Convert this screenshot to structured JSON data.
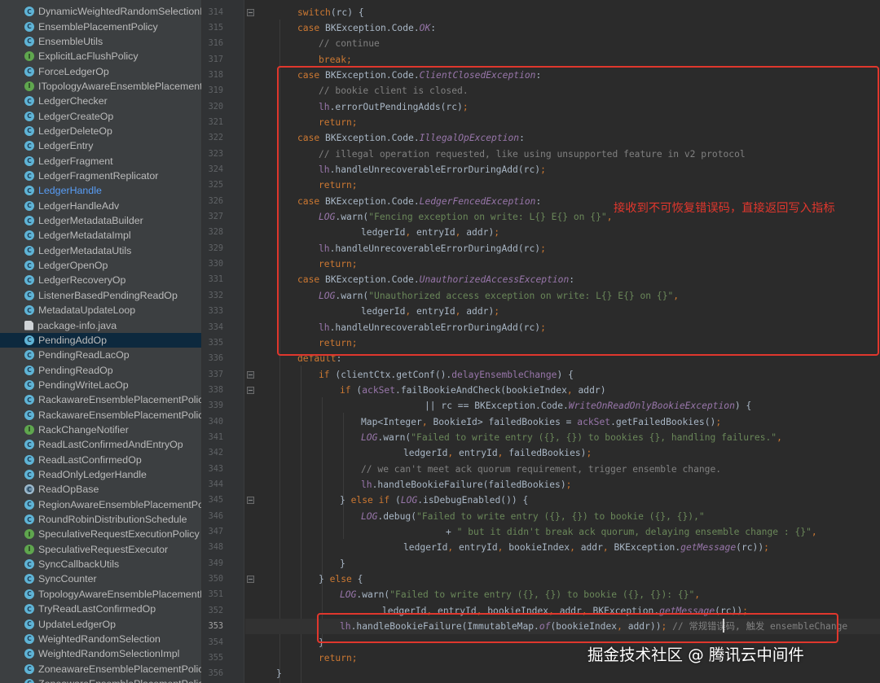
{
  "project_tree": {
    "items": [
      {
        "icon": "class",
        "label": "DynamicWeightedRandomSelectionI"
      },
      {
        "icon": "class",
        "label": "EnsemblePlacementPolicy"
      },
      {
        "icon": "class",
        "label": "EnsembleUtils"
      },
      {
        "icon": "interface",
        "label": "ExplicitLacFlushPolicy"
      },
      {
        "icon": "class",
        "label": "ForceLedgerOp"
      },
      {
        "icon": "interface",
        "label": "ITopologyAwareEnsemblePlacement"
      },
      {
        "icon": "class",
        "label": "LedgerChecker"
      },
      {
        "icon": "class",
        "label": "LedgerCreateOp"
      },
      {
        "icon": "class",
        "label": "LedgerDeleteOp"
      },
      {
        "icon": "class",
        "label": "LedgerEntry"
      },
      {
        "icon": "class",
        "label": "LedgerFragment"
      },
      {
        "icon": "class",
        "label": "LedgerFragmentReplicator"
      },
      {
        "icon": "class",
        "label": "LedgerHandle",
        "link": true
      },
      {
        "icon": "class",
        "label": "LedgerHandleAdv"
      },
      {
        "icon": "class",
        "label": "LedgerMetadataBuilder"
      },
      {
        "icon": "class",
        "label": "LedgerMetadataImpl"
      },
      {
        "icon": "class",
        "label": "LedgerMetadataUtils"
      },
      {
        "icon": "class",
        "label": "LedgerOpenOp"
      },
      {
        "icon": "class",
        "label": "LedgerRecoveryOp"
      },
      {
        "icon": "class",
        "label": "ListenerBasedPendingReadOp"
      },
      {
        "icon": "class",
        "label": "MetadataUpdateLoop"
      },
      {
        "icon": "file",
        "label": "package-info.java"
      },
      {
        "icon": "class",
        "label": "PendingAddOp",
        "selected": true
      },
      {
        "icon": "class",
        "label": "PendingReadLacOp"
      },
      {
        "icon": "class",
        "label": "PendingReadOp"
      },
      {
        "icon": "class",
        "label": "PendingWriteLacOp"
      },
      {
        "icon": "class",
        "label": "RackawareEnsemblePlacementPolicy"
      },
      {
        "icon": "class",
        "label": "RackawareEnsemblePlacementPolicy"
      },
      {
        "icon": "interface",
        "label": "RackChangeNotifier"
      },
      {
        "icon": "class",
        "label": "ReadLastConfirmedAndEntryOp"
      },
      {
        "icon": "class",
        "label": "ReadLastConfirmedOp"
      },
      {
        "icon": "class",
        "label": "ReadOnlyLedgerHandle"
      },
      {
        "icon": "abstract",
        "label": "ReadOpBase"
      },
      {
        "icon": "class",
        "label": "RegionAwareEnsemblePlacementPol"
      },
      {
        "icon": "class",
        "label": "RoundRobinDistributionSchedule"
      },
      {
        "icon": "interface",
        "label": "SpeculativeRequestExecutionPolicy"
      },
      {
        "icon": "interface",
        "label": "SpeculativeRequestExecutor"
      },
      {
        "icon": "class",
        "label": "SyncCallbackUtils"
      },
      {
        "icon": "class",
        "label": "SyncCounter"
      },
      {
        "icon": "class",
        "label": "TopologyAwareEnsemblePlacementP"
      },
      {
        "icon": "class",
        "label": "TryReadLastConfirmedOp"
      },
      {
        "icon": "class",
        "label": "UpdateLedgerOp"
      },
      {
        "icon": "class",
        "label": "WeightedRandomSelection"
      },
      {
        "icon": "class",
        "label": "WeightedRandomSelectionImpl"
      },
      {
        "icon": "class",
        "label": "ZoneawareEnsemblePlacementPolic"
      },
      {
        "icon": "class",
        "label": "ZoneawareEnsemblePlacementPolic"
      }
    ]
  },
  "editor": {
    "current_line": "353",
    "lines": [
      {
        "n": "314",
        "ind": 2,
        "fold": true,
        "segs": [
          [
            "kw",
            "switch"
          ],
          [
            "",
            "(rc) {"
          ]
        ]
      },
      {
        "n": "315",
        "ind": 2,
        "segs": [
          [
            "kw",
            "case "
          ],
          [
            "",
            "BKException.Code."
          ],
          [
            "it",
            "OK"
          ],
          [
            "",
            ":"
          ]
        ]
      },
      {
        "n": "316",
        "ind": 3,
        "segs": [
          [
            "cm",
            "// continue"
          ]
        ]
      },
      {
        "n": "317",
        "ind": 3,
        "segs": [
          [
            "kw",
            "break"
          ],
          [
            "kw",
            ";"
          ]
        ]
      },
      {
        "n": "318",
        "ind": 2,
        "segs": [
          [
            "kw",
            "case "
          ],
          [
            "",
            "BKException.Code."
          ],
          [
            "it",
            "ClientClosedException"
          ],
          [
            "",
            ":"
          ]
        ]
      },
      {
        "n": "319",
        "ind": 3,
        "segs": [
          [
            "cm",
            "// bookie client is closed."
          ]
        ]
      },
      {
        "n": "320",
        "ind": 3,
        "segs": [
          [
            "fld",
            "lh"
          ],
          [
            "",
            ".errorOutPendingAdds(rc)"
          ],
          [
            "kw",
            ";"
          ]
        ]
      },
      {
        "n": "321",
        "ind": 3,
        "segs": [
          [
            "kw",
            "return;"
          ]
        ]
      },
      {
        "n": "322",
        "ind": 2,
        "segs": [
          [
            "kw",
            "case "
          ],
          [
            "",
            "BKException.Code."
          ],
          [
            "it",
            "IllegalOpException"
          ],
          [
            "",
            ":"
          ]
        ]
      },
      {
        "n": "323",
        "ind": 3,
        "segs": [
          [
            "cm",
            "// illegal operation requested, like using unsupported feature in v2 protocol"
          ]
        ]
      },
      {
        "n": "324",
        "ind": 3,
        "segs": [
          [
            "fld",
            "lh"
          ],
          [
            "",
            ".handleUnrecoverableErrorDuringAdd(rc)"
          ],
          [
            "kw",
            ";"
          ]
        ]
      },
      {
        "n": "325",
        "ind": 3,
        "segs": [
          [
            "kw",
            "return;"
          ]
        ]
      },
      {
        "n": "326",
        "ind": 2,
        "segs": [
          [
            "kw",
            "case "
          ],
          [
            "",
            "BKException.Code."
          ],
          [
            "it",
            "LedgerFencedException"
          ],
          [
            "",
            ":"
          ]
        ]
      },
      {
        "n": "327",
        "ind": 3,
        "segs": [
          [
            "log",
            "LOG"
          ],
          [
            "",
            ".warn("
          ],
          [
            "str",
            "\"Fencing exception on write: L{} E{} on {}\""
          ],
          [
            "kw",
            ","
          ]
        ]
      },
      {
        "n": "328",
        "ind": 5,
        "segs": [
          [
            "",
            "ledgerId"
          ],
          [
            "kw",
            ", "
          ],
          [
            "",
            "entryId"
          ],
          [
            "kw",
            ", "
          ],
          [
            "",
            "addr)"
          ],
          [
            "kw",
            ";"
          ]
        ]
      },
      {
        "n": "329",
        "ind": 3,
        "segs": [
          [
            "fld",
            "lh"
          ],
          [
            "",
            ".handleUnrecoverableErrorDuringAdd(rc)"
          ],
          [
            "kw",
            ";"
          ]
        ]
      },
      {
        "n": "330",
        "ind": 3,
        "segs": [
          [
            "kw",
            "return;"
          ]
        ]
      },
      {
        "n": "331",
        "ind": 2,
        "segs": [
          [
            "kw",
            "case "
          ],
          [
            "",
            "BKException.Code."
          ],
          [
            "it",
            "UnauthorizedAccessException"
          ],
          [
            "",
            ":"
          ]
        ]
      },
      {
        "n": "332",
        "ind": 3,
        "segs": [
          [
            "log",
            "LOG"
          ],
          [
            "",
            ".warn("
          ],
          [
            "str",
            "\"Unauthorized access exception on write: L{} E{} on {}\""
          ],
          [
            "kw",
            ","
          ]
        ]
      },
      {
        "n": "333",
        "ind": 5,
        "segs": [
          [
            "",
            "ledgerId"
          ],
          [
            "kw",
            ", "
          ],
          [
            "",
            "entryId"
          ],
          [
            "kw",
            ", "
          ],
          [
            "",
            "addr)"
          ],
          [
            "kw",
            ";"
          ]
        ]
      },
      {
        "n": "334",
        "ind": 3,
        "segs": [
          [
            "fld",
            "lh"
          ],
          [
            "",
            ".handleUnrecoverableErrorDuringAdd(rc)"
          ],
          [
            "kw",
            ";"
          ]
        ]
      },
      {
        "n": "335",
        "ind": 3,
        "segs": [
          [
            "kw",
            "return;"
          ]
        ]
      },
      {
        "n": "336",
        "ind": 2,
        "segs": [
          [
            "kw",
            "default"
          ],
          [
            "",
            ":"
          ]
        ]
      },
      {
        "n": "337",
        "ind": 3,
        "fold": true,
        "segs": [
          [
            "kw",
            "if "
          ],
          [
            "",
            "(clientCtx.getConf()."
          ],
          [
            "fld",
            "delayEnsembleChange"
          ],
          [
            "",
            ") {"
          ]
        ]
      },
      {
        "n": "338",
        "ind": 4,
        "fold": true,
        "segs": [
          [
            "kw",
            "if "
          ],
          [
            "",
            "("
          ],
          [
            "fld",
            "ackSet"
          ],
          [
            "",
            ".failBookieAndCheck(bookieIndex"
          ],
          [
            "kw",
            ", "
          ],
          [
            "",
            "addr)"
          ]
        ]
      },
      {
        "n": "339",
        "ind": 5,
        "extra": 3,
        "segs": [
          [
            "",
            "|| rc == BKException.Code."
          ],
          [
            "it",
            "WriteOnReadOnlyBookieException"
          ],
          [
            "",
            ") {"
          ]
        ]
      },
      {
        "n": "340",
        "ind": 5,
        "segs": [
          [
            "",
            "Map<Integer"
          ],
          [
            "kw",
            ", "
          ],
          [
            "",
            "BookieId> failedBookies = "
          ],
          [
            "fld",
            "ackSet"
          ],
          [
            "",
            ".getFailedBookies()"
          ],
          [
            "kw",
            ";"
          ]
        ]
      },
      {
        "n": "341",
        "ind": 5,
        "segs": [
          [
            "log",
            "LOG"
          ],
          [
            "",
            ".warn("
          ],
          [
            "str",
            "\"Failed to write entry ({}, {}) to bookies {}, handling failures.\""
          ],
          [
            "kw",
            ","
          ]
        ]
      },
      {
        "n": "342",
        "ind": 7,
        "segs": [
          [
            "",
            "ledgerId"
          ],
          [
            "kw",
            ", "
          ],
          [
            "",
            "entryId"
          ],
          [
            "kw",
            ", "
          ],
          [
            "",
            "failedBookies)"
          ],
          [
            "kw",
            ";"
          ]
        ]
      },
      {
        "n": "343",
        "ind": 5,
        "segs": [
          [
            "cm",
            "// we can't meet ack quorum requirement, trigger ensemble change."
          ]
        ]
      },
      {
        "n": "344",
        "ind": 5,
        "segs": [
          [
            "fld",
            "lh"
          ],
          [
            "",
            ".handleBookieFailure(failedBookies)"
          ],
          [
            "kw",
            ";"
          ]
        ]
      },
      {
        "n": "345",
        "ind": 4,
        "fold": true,
        "segs": [
          [
            "",
            "} "
          ],
          [
            "kw",
            "else if "
          ],
          [
            "",
            "("
          ],
          [
            "log",
            "LOG"
          ],
          [
            "",
            ".isDebugEnabled()) {"
          ]
        ]
      },
      {
        "n": "346",
        "ind": 5,
        "segs": [
          [
            "log",
            "LOG"
          ],
          [
            "",
            ".debug("
          ],
          [
            "str",
            "\"Failed to write entry ({}, {}) to bookie ({}, {}),\""
          ]
        ]
      },
      {
        "n": "347",
        "ind": 9,
        "segs": [
          [
            "",
            "+ "
          ],
          [
            "str",
            "\" but it didn't break ack quorum, delaying ensemble change : {}\""
          ],
          [
            "kw",
            ","
          ]
        ]
      },
      {
        "n": "348",
        "ind": 7,
        "segs": [
          [
            "",
            "ledgerId"
          ],
          [
            "kw",
            ", "
          ],
          [
            "",
            "entryId"
          ],
          [
            "kw",
            ", "
          ],
          [
            "",
            "bookieIndex"
          ],
          [
            "kw",
            ", "
          ],
          [
            "",
            "addr"
          ],
          [
            "kw",
            ", "
          ],
          [
            "",
            "BKException."
          ],
          [
            "it",
            "getMessage"
          ],
          [
            "",
            "(rc))"
          ],
          [
            "kw",
            ";"
          ]
        ]
      },
      {
        "n": "349",
        "ind": 4,
        "segs": [
          [
            "",
            "}"
          ]
        ]
      },
      {
        "n": "350",
        "ind": 3,
        "fold": true,
        "segs": [
          [
            "",
            "} "
          ],
          [
            "kw",
            "else "
          ],
          [
            "",
            "{"
          ]
        ]
      },
      {
        "n": "351",
        "ind": 4,
        "segs": [
          [
            "log",
            "LOG"
          ],
          [
            "",
            ".warn("
          ],
          [
            "str",
            "\"Failed to write entry ({}, {}) to bookie ({}, {}): {}\""
          ],
          [
            "kw",
            ","
          ]
        ]
      },
      {
        "n": "352",
        "ind": 6,
        "segs": [
          [
            "",
            "ledgerId"
          ],
          [
            "kw",
            ", "
          ],
          [
            "",
            "entryId"
          ],
          [
            "kw",
            ", "
          ],
          [
            "",
            "bookieIndex"
          ],
          [
            "kw",
            ", "
          ],
          [
            "",
            "addr"
          ],
          [
            "kw",
            ", "
          ],
          [
            "",
            "BKException."
          ],
          [
            "it",
            "getMessage"
          ],
          [
            "",
            "(rc))"
          ],
          [
            "kw",
            ";"
          ]
        ]
      },
      {
        "n": "353",
        "ind": 4,
        "segs": [
          [
            "fld",
            "lh"
          ],
          [
            "",
            ".handleBookieFailure(ImmutableMap."
          ],
          [
            "it",
            "of"
          ],
          [
            "",
            "(bookieIndex"
          ],
          [
            "kw",
            ", "
          ],
          [
            "",
            "addr))"
          ],
          [
            "kw",
            "; "
          ],
          [
            "cm",
            "// 常规错误码, 触发 ensembleChange"
          ]
        ]
      },
      {
        "n": "354",
        "ind": 3,
        "segs": [
          [
            "",
            "}"
          ]
        ]
      },
      {
        "n": "355",
        "ind": 3,
        "segs": [
          [
            "kw",
            "return;"
          ]
        ]
      },
      {
        "n": "356",
        "ind": 1,
        "segs": [
          [
            "",
            "}"
          ]
        ]
      }
    ]
  },
  "annotation": {
    "text": "接收到不可恢复错误码，直接返回写入指标",
    "color": "#e0372d"
  },
  "watermark": {
    "text": "掘金技术社区 @ 腾讯云中间件"
  },
  "colors": {
    "keyword": "#cc7832",
    "comment": "#808080",
    "string": "#6a8759",
    "field": "#9876aa",
    "plain": "#a9b7c6",
    "highlight_box": "#e0372d"
  }
}
